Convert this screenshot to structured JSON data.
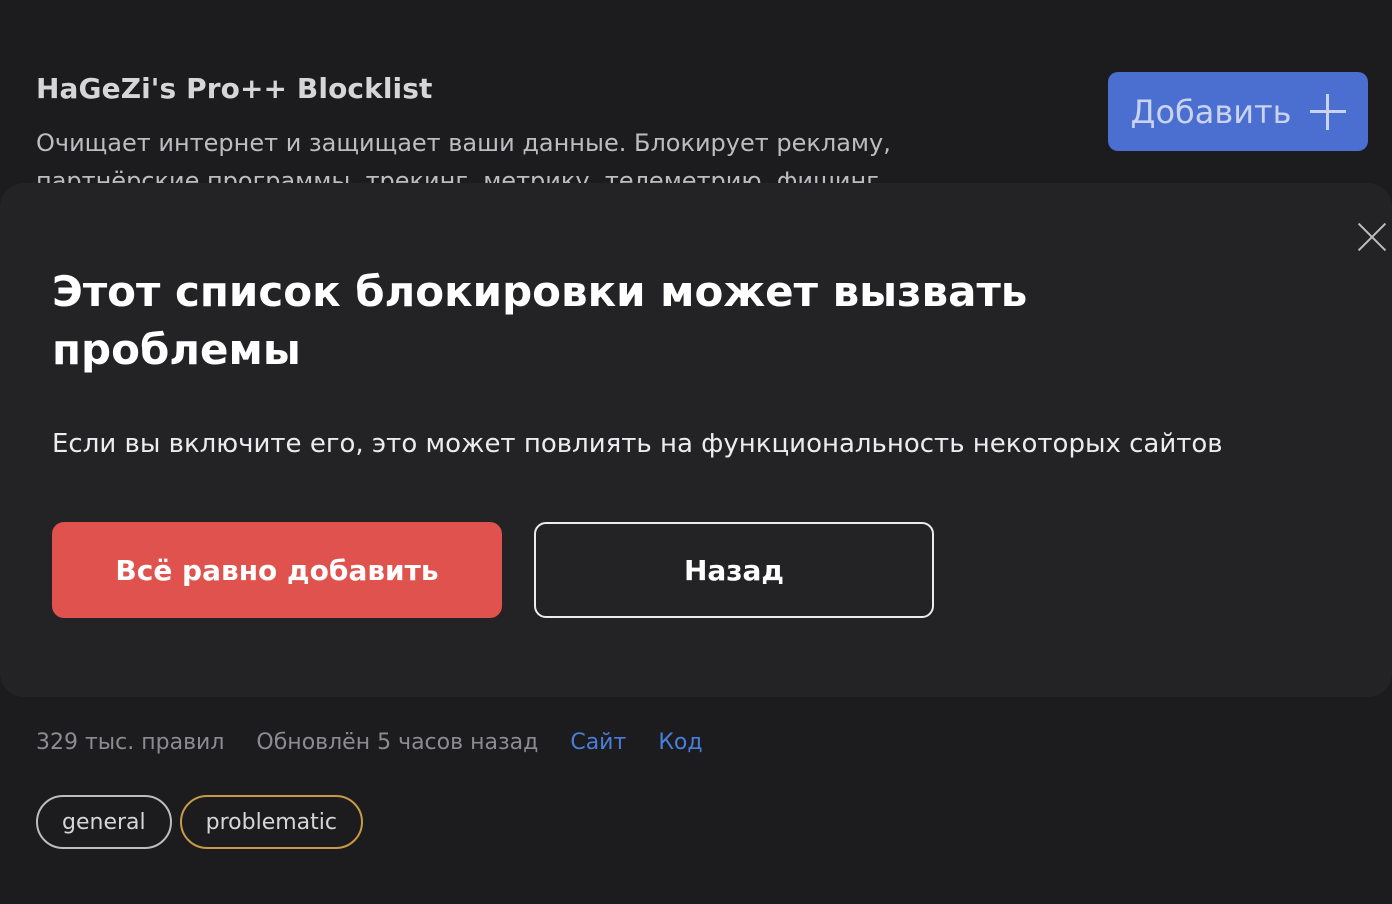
{
  "blocklist": {
    "title": "HaGeZi's Pro++ Blocklist",
    "description": "Очищает интернет и защищает ваши данные. Блокирует рекламу, партнёрские программы, трекинг, метрику, телеметрию, фишинг",
    "add_label": "Добавить",
    "add_icon": "plus-icon",
    "rules_count": "329 тыс. правил",
    "updated": "Обновлён 5 часов назад",
    "links": {
      "site": "Сайт",
      "code": "Код"
    },
    "tags": {
      "general": "general",
      "problematic": "problematic"
    }
  },
  "modal": {
    "title": "Этот список блокировки может вызвать проблемы",
    "text": "Если вы включите его, это может повлиять на функциональность некоторых сайтов",
    "confirm_label": "Всё равно добавить",
    "back_label": "Назад",
    "close_icon": "close-icon"
  },
  "colors": {
    "background": "#1c1c1e",
    "modal_background": "#232326",
    "accent_blue": "#4a6fd1",
    "link_blue": "#4a7dd9",
    "danger_red": "#e0524d",
    "tag_warning_border": "#c99a45"
  }
}
